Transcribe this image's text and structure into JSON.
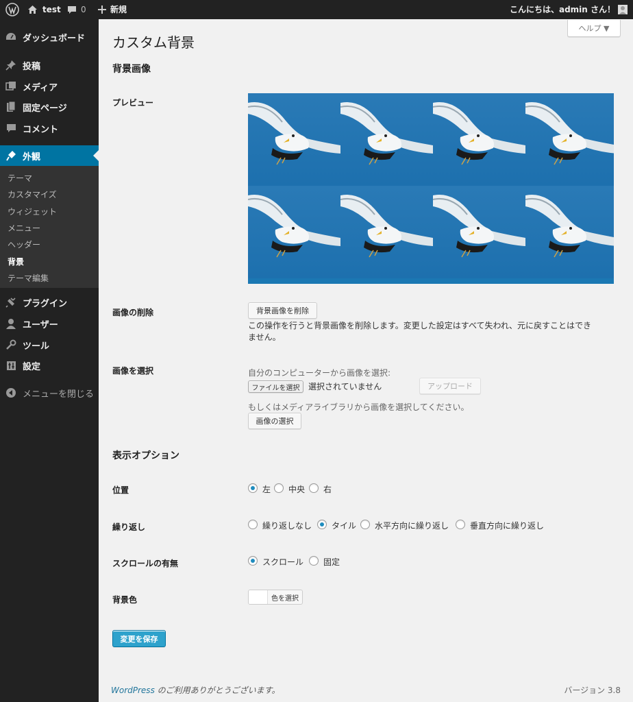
{
  "adminbar": {
    "site_name": "test",
    "comments_count": "0",
    "new_label": "新規",
    "greeting": "こんにちは、admin さん！"
  },
  "sidebar": {
    "items": [
      {
        "label": "ダッシュボード",
        "icon": "dashboard-icon"
      },
      {
        "label": "投稿",
        "icon": "pin-icon"
      },
      {
        "label": "メディア",
        "icon": "media-icon"
      },
      {
        "label": "固定ページ",
        "icon": "page-icon"
      },
      {
        "label": "コメント",
        "icon": "comment-icon"
      },
      {
        "label": "外観",
        "icon": "appearance-icon"
      }
    ],
    "submenu": [
      "テーマ",
      "カスタマイズ",
      "ウィジェット",
      "メニュー",
      "ヘッダー",
      "背景",
      "テーマ編集"
    ],
    "items_after": [
      {
        "label": "プラグイン",
        "icon": "plugin-icon"
      },
      {
        "label": "ユーザー",
        "icon": "user-icon"
      },
      {
        "label": "ツール",
        "icon": "tool-icon"
      },
      {
        "label": "設定",
        "icon": "settings-icon"
      }
    ],
    "collapse_label": "メニューを閉じる"
  },
  "help_tab": "ヘルプ ▼",
  "page_title": "カスタム背景",
  "section_bg_image": "背景画像",
  "preview_label": "プレビュー",
  "remove": {
    "label": "画像の削除",
    "button": "背景画像を削除",
    "note_line1": "この操作を行うと背景画像を削除します。変更した設定はすべて失われ、元に戻すことはでき",
    "note_line2": "ません。"
  },
  "select": {
    "label": "画像を選択",
    "from_computer": "自分のコンピューターから画像を選択:",
    "file_button": "ファイルを選択",
    "no_file": "選択されていません",
    "upload_button": "アップロード",
    "from_library": "もしくはメディアライブラリから画像を選択してください。",
    "choose_button": "画像の選択"
  },
  "section_display": "表示オプション",
  "position": {
    "label": "位置",
    "options": [
      "左",
      "中央",
      "右"
    ],
    "selected": 0
  },
  "repeat": {
    "label": "繰り返し",
    "options": [
      "繰り返しなし",
      "タイル",
      "水平方向に繰り返し",
      "垂直方向に繰り返し"
    ],
    "selected": 1
  },
  "attachment": {
    "label": "スクロールの有無",
    "options": [
      "スクロール",
      "固定"
    ],
    "selected": 0
  },
  "color": {
    "label": "背景色",
    "button": "色を選択"
  },
  "save_button": "変更を保存",
  "footer": {
    "wp_link": "WordPress",
    "thanks": " のご利用ありがとうございます。",
    "version": "バージョン 3.8"
  },
  "colors": {
    "adminbar": "#222222",
    "sidebar": "#222222",
    "active": "#0074a2",
    "primary": "#2ea2cc"
  }
}
